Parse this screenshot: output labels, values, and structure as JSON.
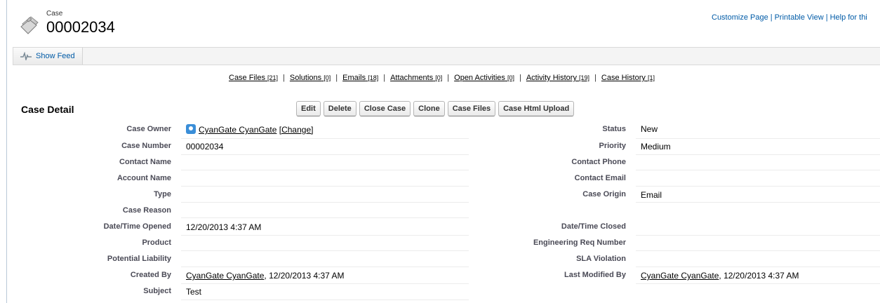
{
  "header": {
    "object_label": "Case",
    "record_number": "00002034",
    "links": [
      "Customize Page",
      "Printable View",
      "Help for thi"
    ]
  },
  "feed": {
    "show_feed_label": "Show Feed"
  },
  "related_lists": [
    {
      "label": "Case Files",
      "count": "[21]"
    },
    {
      "label": "Solutions",
      "count": "[0]"
    },
    {
      "label": "Emails",
      "count": "[18]"
    },
    {
      "label": "Attachments",
      "count": "[0]"
    },
    {
      "label": "Open Activities",
      "count": "[0]"
    },
    {
      "label": "Activity History",
      "count": "[19]"
    },
    {
      "label": "Case History",
      "count": "[1]"
    }
  ],
  "detail": {
    "title": "Case Detail",
    "buttons": [
      "Edit",
      "Delete",
      "Close Case",
      "Clone",
      "Case Files",
      "Case Html Upload"
    ],
    "left_fields": [
      {
        "label": "Case Owner",
        "value": "CyanGate CyanGate",
        "suffix": "[Change]"
      },
      {
        "label": "Case Number",
        "value": "00002034"
      },
      {
        "label": "Contact Name",
        "value": ""
      },
      {
        "label": "Account Name",
        "value": ""
      },
      {
        "label": "Type",
        "value": ""
      },
      {
        "label": "Case Reason",
        "value": ""
      },
      {
        "label": "Date/Time Opened",
        "value": "12/20/2013 4:37 AM"
      },
      {
        "label": "Product",
        "value": ""
      },
      {
        "label": "Potential Liability",
        "value": ""
      },
      {
        "label": "Created By",
        "value_link": "CyanGate CyanGate",
        "value": ", 12/20/2013 4:37 AM"
      },
      {
        "label": "Subject",
        "value": "Test"
      }
    ],
    "right_fields": [
      {
        "label": "Status",
        "value": "New"
      },
      {
        "label": "Priority",
        "value": "Medium"
      },
      {
        "label": "Contact Phone",
        "value": ""
      },
      {
        "label": "Contact Email",
        "value": ""
      },
      {
        "label": "Case Origin",
        "value": "Email"
      },
      {
        "label": "Date/Time Closed",
        "value": ""
      },
      {
        "label": "Engineering Req Number",
        "value": ""
      },
      {
        "label": "SLA Violation",
        "value": ""
      },
      {
        "label": "Last Modified By",
        "value_link": "CyanGate CyanGate",
        "value": ", 12/20/2013 4:37 AM"
      }
    ]
  },
  "icons": {
    "case": "case-briefcase-icon",
    "feed": "pulse-icon",
    "owner": "user-avatar-icon"
  },
  "colors": {
    "link_blue": "#015ba7",
    "label_gray": "#4a4a56",
    "owner_icon": "#3a8ed8"
  }
}
